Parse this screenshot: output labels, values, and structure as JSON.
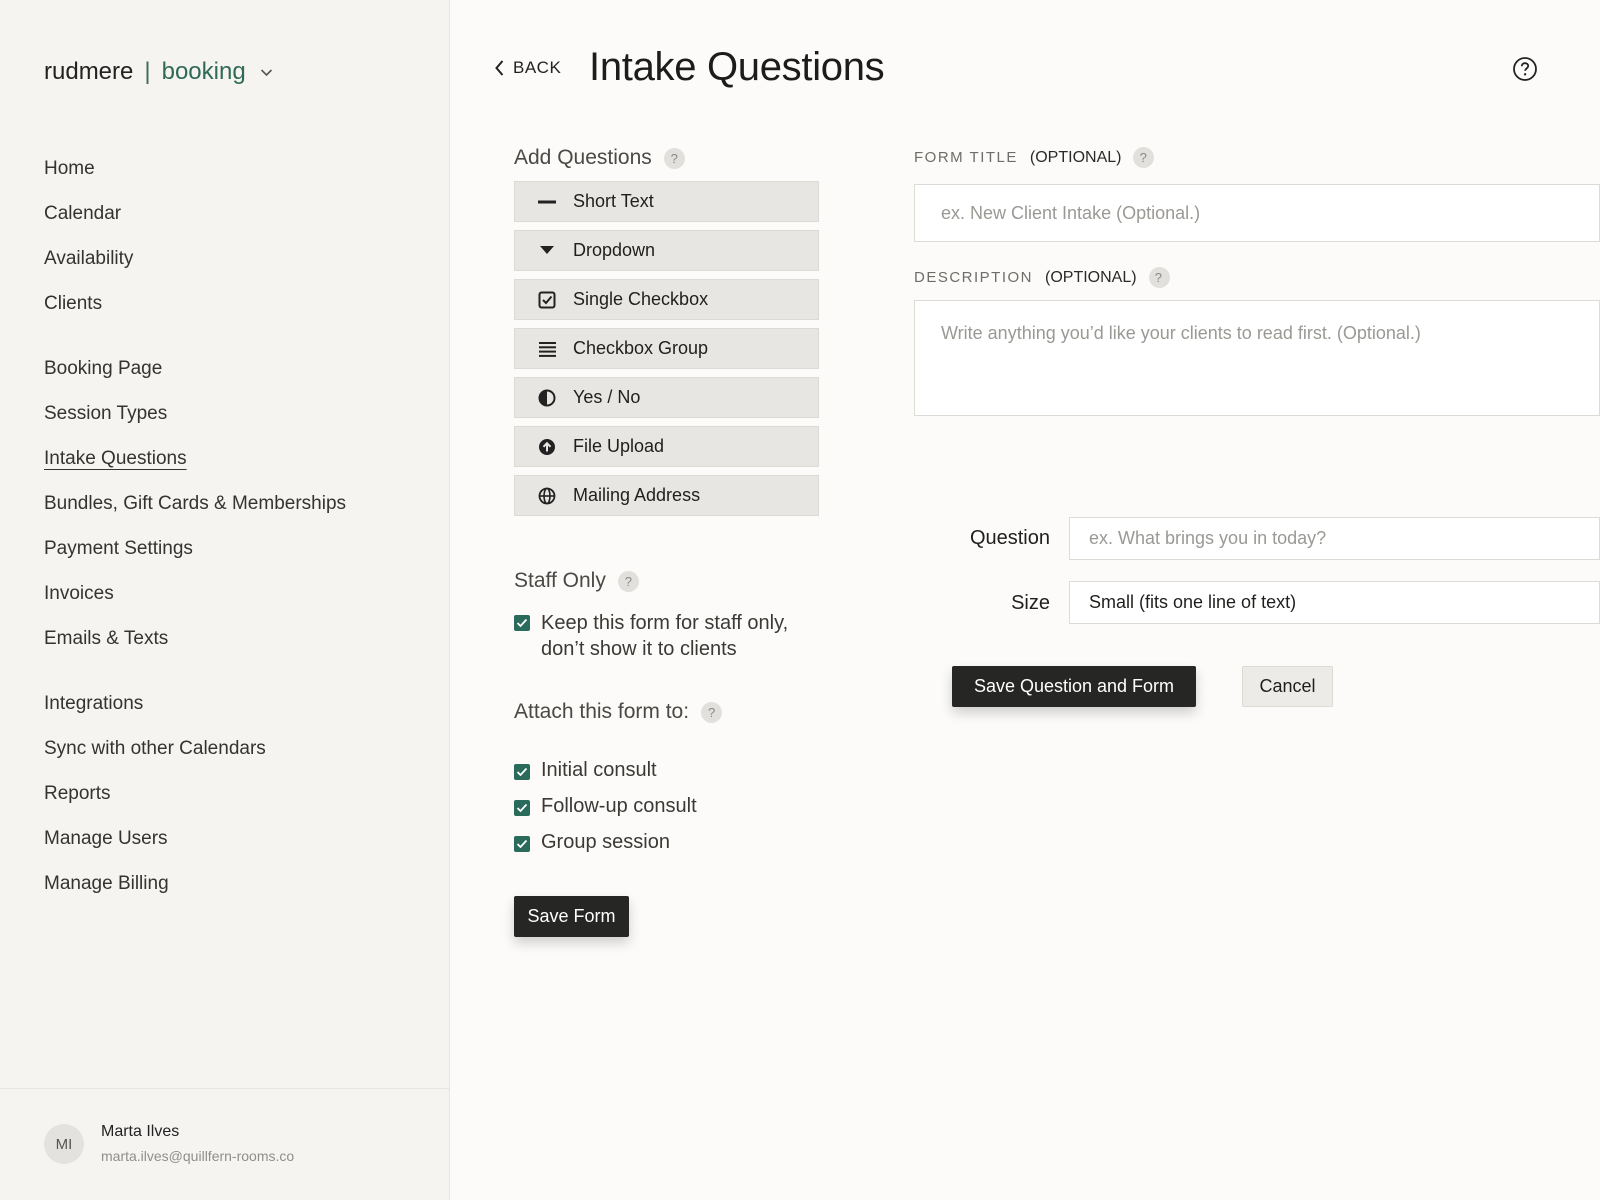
{
  "brand": {
    "name": "rudmere",
    "separator": "|",
    "product": "booking"
  },
  "nav": {
    "group1": [
      "Home",
      "Calendar",
      "Availability",
      "Clients"
    ],
    "group2": [
      "Booking Page",
      "Session Types",
      "Intake Questions",
      "Bundles, Gift Cards & Memberships",
      "Payment Settings",
      "Invoices",
      "Emails & Texts"
    ],
    "group3": [
      "Integrations",
      "Sync with other Calendars",
      "Reports",
      "Manage Users",
      "Manage Billing"
    ],
    "active": "Intake Questions"
  },
  "user": {
    "initials": "MI",
    "name": "Marta Ilves",
    "email": "marta.ilves@quillfern-rooms.co"
  },
  "header": {
    "back_label": "BACK",
    "title": "Intake Questions",
    "help_icon": "help-circle-icon"
  },
  "add_questions": {
    "label": "Add Questions",
    "help": "?",
    "types": [
      {
        "label": "Short Text",
        "icon": "dash-icon"
      },
      {
        "label": "Dropdown",
        "icon": "triangle-down-icon"
      },
      {
        "label": "Single Checkbox",
        "icon": "checkbox-icon"
      },
      {
        "label": "Checkbox Group",
        "icon": "list-icon"
      },
      {
        "label": "Yes / No",
        "icon": "half-circle-icon"
      },
      {
        "label": "File Upload",
        "icon": "upload-icon"
      },
      {
        "label": "Mailing Address",
        "icon": "globe-icon"
      }
    ]
  },
  "staff_only": {
    "label": "Staff Only",
    "help": "?",
    "checkbox_line1": "Keep this form for staff only,",
    "checkbox_line2": "don’t show it to clients",
    "checked": true
  },
  "attach": {
    "label": "Attach this form to:",
    "help": "?",
    "sessions": [
      {
        "label": "Initial consult",
        "checked": true
      },
      {
        "label": "Follow-up consult",
        "checked": true
      },
      {
        "label": "Group session",
        "checked": true
      }
    ]
  },
  "save_form_label": "Save Form",
  "form": {
    "title_label": "FORM TITLE",
    "title_optional": "(OPTIONAL)",
    "title_placeholder": "ex. New Client Intake (Optional.)",
    "desc_label": "DESCRIPTION",
    "desc_optional": "(OPTIONAL)",
    "desc_placeholder": "Write anything you’d like your clients to read first. (Optional.)",
    "help": "?"
  },
  "question_editor": {
    "question_label": "Question",
    "question_placeholder": "ex. What brings you in today?",
    "size_label": "Size",
    "size_value": "Small (fits one line of text)",
    "save_label": "Save Question and Form",
    "cancel_label": "Cancel"
  },
  "colors": {
    "accent": "#2a6b5c",
    "brand_green": "#2f6a57",
    "dark_button": "#262624"
  }
}
